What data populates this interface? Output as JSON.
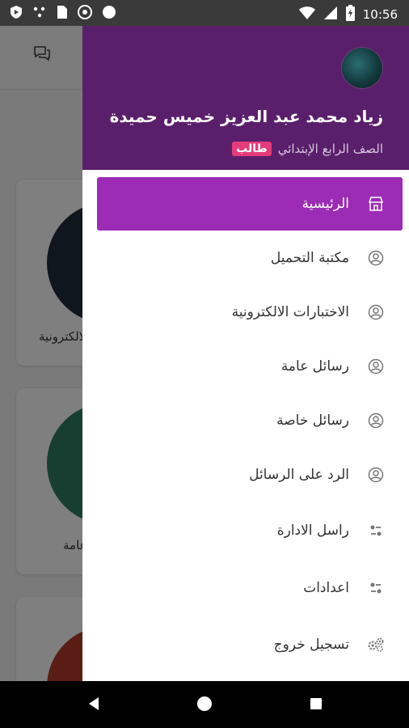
{
  "status_bar": {
    "time": "10:56",
    "icons": [
      "shield-icon",
      "dots-icon",
      "sim-card-icon",
      "chrome-icon",
      "circle-icon",
      "wifi-icon",
      "signal-icon",
      "battery-icon"
    ]
  },
  "background": {
    "cards": [
      {
        "label": "الاختبارات الالكترونية",
        "color": "#1f2d3a"
      },
      {
        "label": "رسائل عامة",
        "color": "#2f7d62"
      },
      {
        "label": "",
        "color": "#b23a2b"
      }
    ]
  },
  "drawer": {
    "user_name": "زياد محمد عبد العزيز خميس حميدة",
    "role": "طالب",
    "grade": "الصف الرابع الإبتدائي",
    "header_color": "#5a1f6b",
    "active_color": "#9c2bb5",
    "items": [
      {
        "label": "الرئيسية",
        "icon": "store-icon",
        "active": true
      },
      {
        "label": "مكتبة التحميل",
        "icon": "user-circle-icon",
        "active": false
      },
      {
        "label": "الاختبارات الالكترونية",
        "icon": "user-circle-icon",
        "active": false
      },
      {
        "label": "رسائل عامة",
        "icon": "user-circle-icon",
        "active": false
      },
      {
        "label": "رسائل خاصة",
        "icon": "user-circle-icon",
        "active": false
      },
      {
        "label": "الرد على الرسائل",
        "icon": "user-circle-icon",
        "active": false
      },
      {
        "label": "راسل الادارة",
        "icon": "toggle-icon",
        "active": false
      },
      {
        "label": "اعدادات",
        "icon": "toggle-icon",
        "active": false
      },
      {
        "label": "تسجيل خروج",
        "icon": "gears-icon",
        "active": false
      }
    ]
  }
}
